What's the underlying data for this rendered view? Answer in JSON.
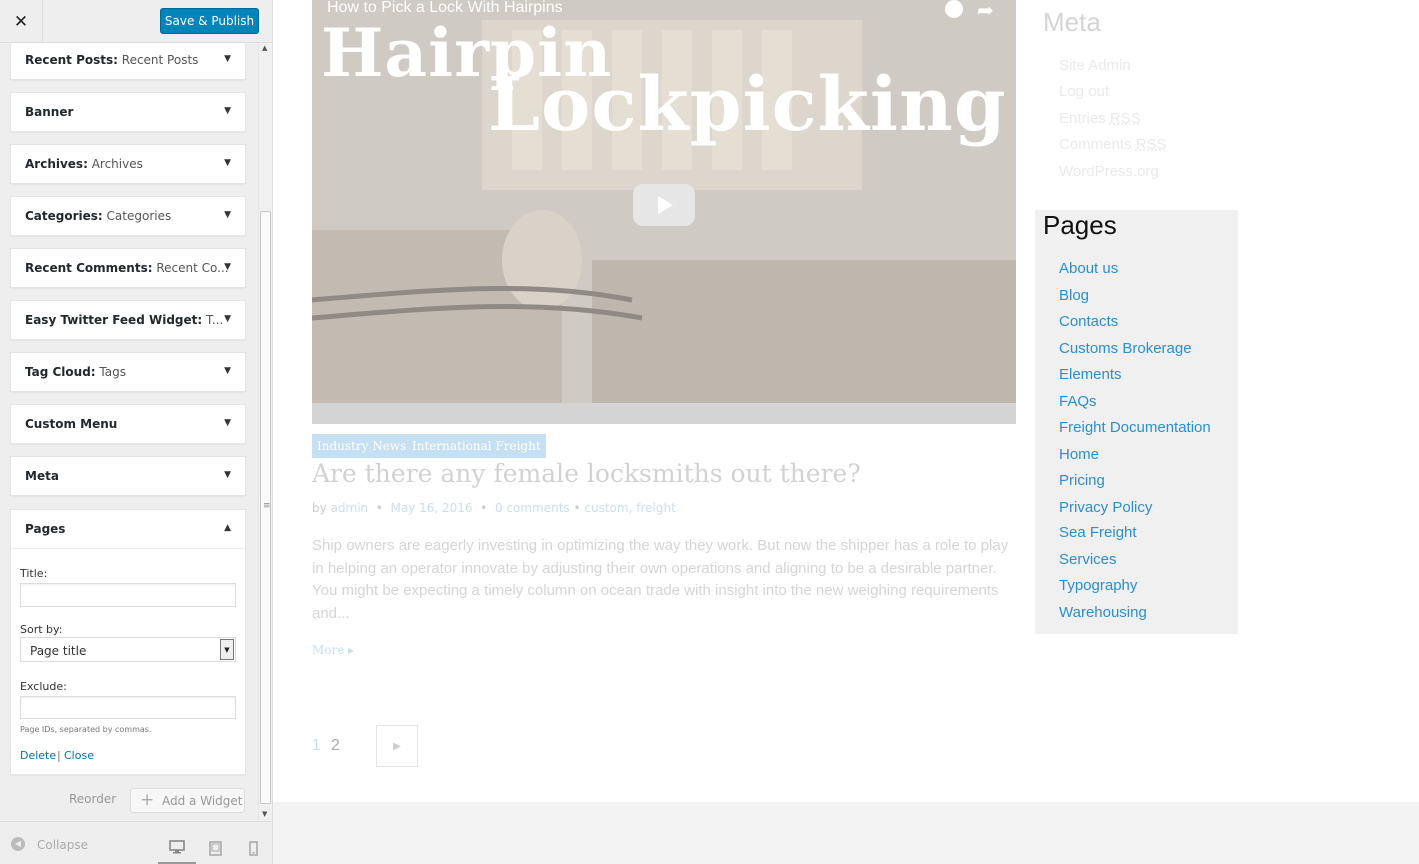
{
  "customizer": {
    "close_icon": "close-icon",
    "publish_label": "Save & Publish",
    "widgets": [
      {
        "name": "Recent Posts:",
        "subtitle": " Recent Posts"
      },
      {
        "name": "Banner",
        "subtitle": ""
      },
      {
        "name": "Archives:",
        "subtitle": " Archives"
      },
      {
        "name": "Categories:",
        "subtitle": " Categories"
      },
      {
        "name": "Recent Comments:",
        "subtitle": " Recent Co..."
      },
      {
        "name": "Easy Twitter Feed Widget:",
        "subtitle": " T..."
      },
      {
        "name": "Tag Cloud:",
        "subtitle": " Tags"
      },
      {
        "name": "Custom Menu",
        "subtitle": ""
      },
      {
        "name": "Meta",
        "subtitle": ""
      }
    ],
    "pages_widget": {
      "name": "Pages",
      "title_label": "Title:",
      "title_value": "",
      "sort_label": "Sort by:",
      "sort_value": "Page title",
      "exclude_label": "Exclude:",
      "exclude_value": "",
      "exclude_help": "Page IDs, separated by commas.",
      "delete_label": "Delete",
      "separator": "|",
      "close_label": "Close"
    },
    "reorder_label": "Reorder",
    "add_widget_label": "Add a Widget",
    "collapse_label": "Collapse",
    "devices": [
      "desktop-icon",
      "tablet-icon",
      "mobile-icon"
    ],
    "active_device": "desktop"
  },
  "preview": {
    "video": {
      "title": "How to Pick a Lock With Hairpins",
      "overlay_line1": "Hairpin",
      "overlay_line2": "Lockpicking"
    },
    "post": {
      "categories": [
        "Industry News",
        "International Freight"
      ],
      "title": "Are there any female locksmiths out there?",
      "meta": {
        "by": "by",
        "author": "admin",
        "dot": "•",
        "date": "May 16, 2016",
        "comments": "0 comments",
        "tags_prefix": "•",
        "tag1": "custom",
        "tag_sep": ",",
        "tag2": "freight"
      },
      "excerpt": "Ship owners are eagerly investing in optimizing the way they work. But now the shipper has a role to play in helping an operator innovate by adjusting their own operations and aligning to be a desirable partner. You might be expecting a timely column on ocean trade with insight into the new weighing requirements and...",
      "more_label": "More ▸"
    },
    "pagination": {
      "pages": [
        "1",
        "2"
      ],
      "current": "1"
    },
    "meta_widget": {
      "heading": "Meta",
      "links": [
        {
          "text": "Site Admin",
          "abbr": ""
        },
        {
          "text": "Log out",
          "abbr": ""
        },
        {
          "text": "Entries ",
          "abbr": "RSS"
        },
        {
          "text": "Comments ",
          "abbr": "RSS"
        },
        {
          "text": "WordPress.org",
          "abbr": ""
        }
      ]
    },
    "pages_widget": {
      "heading": "Pages",
      "links": [
        "About us",
        "Blog",
        "Contacts",
        "Customs Brokerage",
        "Elements",
        "FAQs",
        "Freight Documentation",
        "Home",
        "Pricing",
        "Privacy Policy",
        "Sea Freight",
        "Services",
        "Typography",
        "Warehousing"
      ]
    }
  },
  "colors": {
    "primary_button": "#0085ba",
    "link": "#2a8fd3",
    "tag_bg": "#c5dff3"
  }
}
